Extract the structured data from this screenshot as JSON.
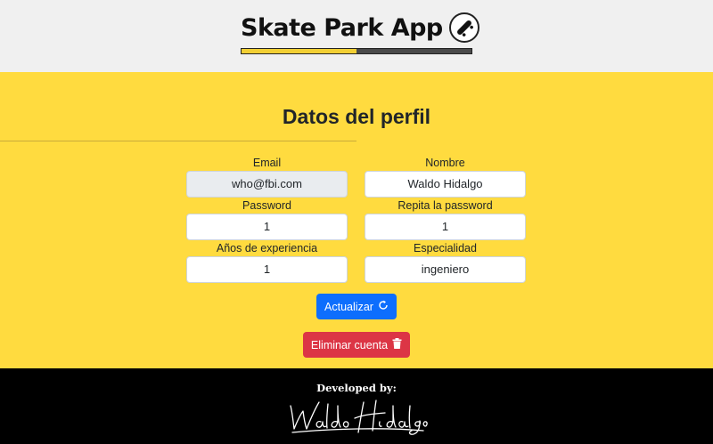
{
  "header": {
    "app_title": "Skate Park App",
    "logo_icon": "skateboard-icon",
    "progress_fraction": 0.5,
    "progress_color": "#f2cf34"
  },
  "main": {
    "page_title": "Datos del perfil",
    "background_color": "#ffdb3f",
    "fields": {
      "email": {
        "label": "Email",
        "value": "who@fbi.com",
        "disabled": true
      },
      "nombre": {
        "label": "Nombre",
        "value": "Waldo Hidalgo"
      },
      "password": {
        "label": "Password",
        "value": "1"
      },
      "repita_password": {
        "label": "Repita la password",
        "value": "1"
      },
      "experiencia": {
        "label": "Años de experiencia",
        "value": "1"
      },
      "especialidad": {
        "label": "Especialidad",
        "value": "ingeniero"
      }
    },
    "buttons": {
      "update": {
        "label": "Actualizar",
        "icon": "refresh-icon",
        "color": "#0d6efd"
      },
      "delete": {
        "label": "Eliminar cuenta",
        "icon": "trash-icon",
        "color": "#dc3545"
      }
    }
  },
  "footer": {
    "developed_by": "Developed by:",
    "signature": "Waldo Hidalgo"
  }
}
